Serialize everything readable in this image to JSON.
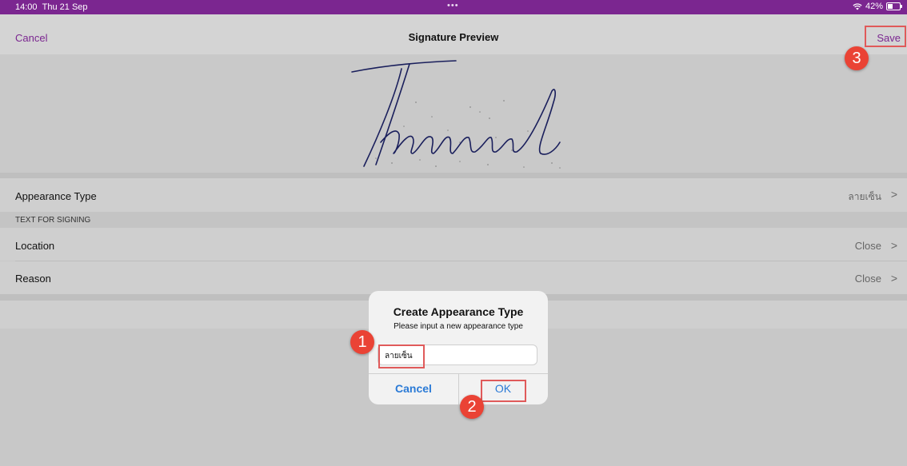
{
  "status_bar": {
    "time": "14:00",
    "date": "Thu 21 Sep",
    "center_dots": "•••",
    "battery": "42%",
    "battery_level": 0.42
  },
  "nav": {
    "cancel": "Cancel",
    "title": "Signature Preview",
    "save": "Save"
  },
  "signature": {
    "text": "Thanaual"
  },
  "rows": {
    "appearance_type": {
      "label": "Appearance Type",
      "value": "ลายเซ็น"
    },
    "section_header": "TEXT FOR SIGNING",
    "location": {
      "label": "Location",
      "value": "Close"
    },
    "reason": {
      "label": "Reason",
      "value": "Close"
    }
  },
  "dialog": {
    "title": "Create Appearance Type",
    "message": "Please input a new appearance type",
    "input_value": "ลายเซ็น",
    "cancel": "Cancel",
    "ok": "OK"
  },
  "badges": {
    "b1": "1",
    "b2": "2",
    "b3": "3"
  },
  "colors": {
    "accent": "#7b2690",
    "dialog_button": "#2a7ad6",
    "badge": "#ea4335",
    "highlight": "#e05a5a"
  }
}
